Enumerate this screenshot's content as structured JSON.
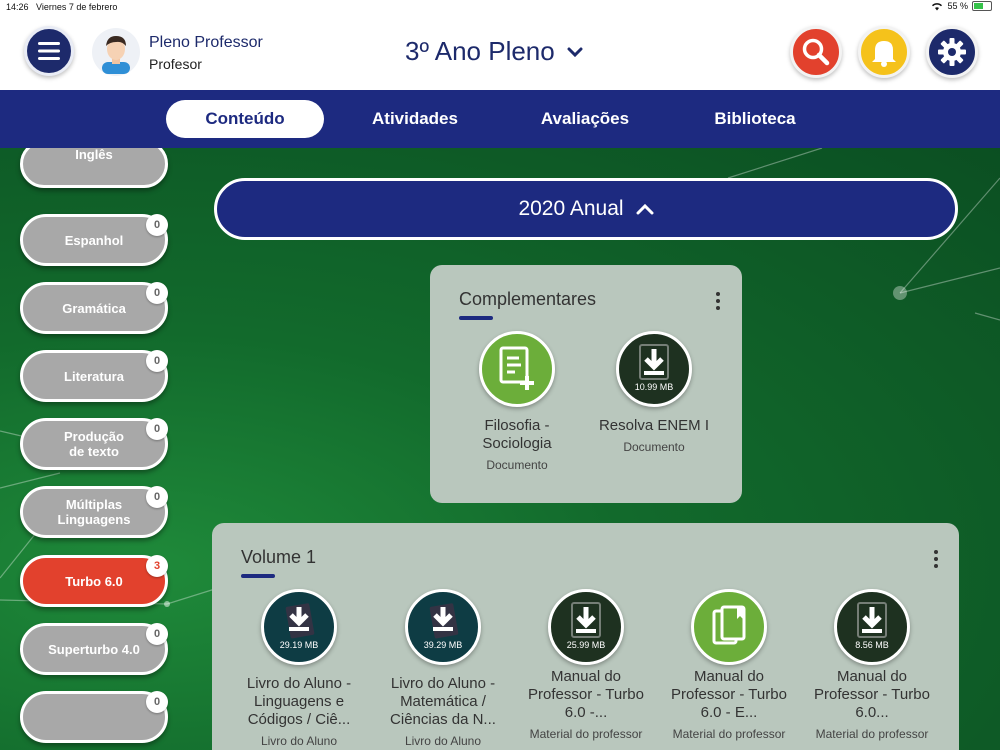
{
  "status_bar": {
    "time": "14:26",
    "date": "Viernes 7 de febrero",
    "battery": "55 %"
  },
  "header": {
    "user_name": "Pleno Professor",
    "user_role": "Profesor",
    "class_title": "3º Ano Pleno"
  },
  "tabs": [
    {
      "label": "Conteúdo",
      "active": true
    },
    {
      "label": "Atividades",
      "active": false
    },
    {
      "label": "Avaliações",
      "active": false
    },
    {
      "label": "Biblioteca",
      "active": false
    }
  ],
  "sidebar": [
    {
      "label": "Inglês",
      "count": ""
    },
    {
      "label": "Espanhol",
      "count": "0"
    },
    {
      "label": "Gramática",
      "count": "0"
    },
    {
      "label": "Literatura",
      "count": "0"
    },
    {
      "label": "Produção de texto",
      "count": "0"
    },
    {
      "label": "Múltiplas Linguagens",
      "count": "0"
    },
    {
      "label": "Turbo 6.0",
      "count": "3",
      "active": true
    },
    {
      "label": "Superturbo 4.0",
      "count": "0"
    },
    {
      "label": "",
      "count": "0"
    }
  ],
  "year_selector": "2020 Anual",
  "complementares": {
    "title": "Complementares",
    "items": [
      {
        "title": "Filosofia - Sociologia",
        "type": "Documento",
        "size": "",
        "icon": "document-add-icon"
      },
      {
        "title": "Resolva ENEM I",
        "type": "Documento",
        "size": "10.99 MB",
        "icon": "download-icon"
      }
    ]
  },
  "volume": {
    "title": "Volume 1",
    "items": [
      {
        "title": "Livro do Aluno - Linguagens e Códigos / Ciê...",
        "type": "Livro do Aluno",
        "size": "29.19 MB",
        "icon": "download-icon"
      },
      {
        "title": "Livro do Aluno - Matemática / Ciências da N...",
        "type": "Livro do Aluno",
        "size": "39.29 MB",
        "icon": "download-icon"
      },
      {
        "title": "Manual do Professor - Turbo 6.0 -...",
        "type": "Material do professor",
        "size": "25.99 MB",
        "icon": "download-icon"
      },
      {
        "title": "Manual do Professor - Turbo 6.0 - E...",
        "type": "Material do professor",
        "size": "",
        "icon": "book-copy-icon"
      },
      {
        "title": "Manual do Professor - Turbo 6.0...",
        "type": "Material do professor",
        "size": "8.56 MB",
        "icon": "download-icon"
      }
    ]
  }
}
